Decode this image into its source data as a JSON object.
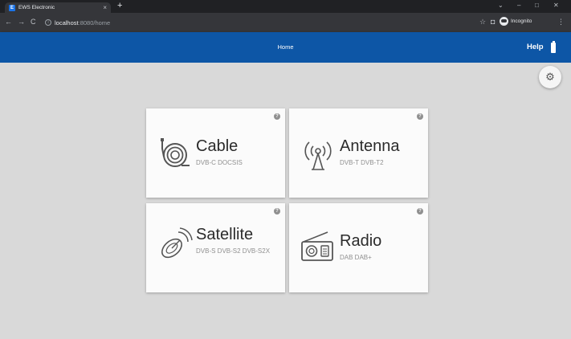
{
  "browser": {
    "tab_title": "EWS Electronic",
    "tab_close": "×",
    "new_tab": "+",
    "window_controls": {
      "chevron": "⌄",
      "minimize": "–",
      "maximize": "□",
      "close": "✕"
    },
    "url_host": "localhost",
    "url_rest": ":8080/home",
    "profile_label": "Incognito",
    "icons": [
      "back-icon",
      "forward-icon",
      "reload-icon",
      "info-icon",
      "star-icon",
      "tab-search-icon",
      "incognito-icon",
      "menu-icon"
    ]
  },
  "app": {
    "title": "Home",
    "help_label": "Help",
    "accent_color": "#0d56a6"
  },
  "cards": [
    {
      "title": "Cable",
      "subtitle": "DVB-C DOCSIS",
      "icon": "cable-icon"
    },
    {
      "title": "Antenna",
      "subtitle": "DVB-T DVB-T2",
      "icon": "antenna-icon"
    },
    {
      "title": "Satellite",
      "subtitle": "DVB-S DVB-S2 DVB-S2X",
      "icon": "satellite-dish-icon"
    },
    {
      "title": "Radio",
      "subtitle": "DAB DAB+",
      "icon": "radio-icon"
    }
  ]
}
